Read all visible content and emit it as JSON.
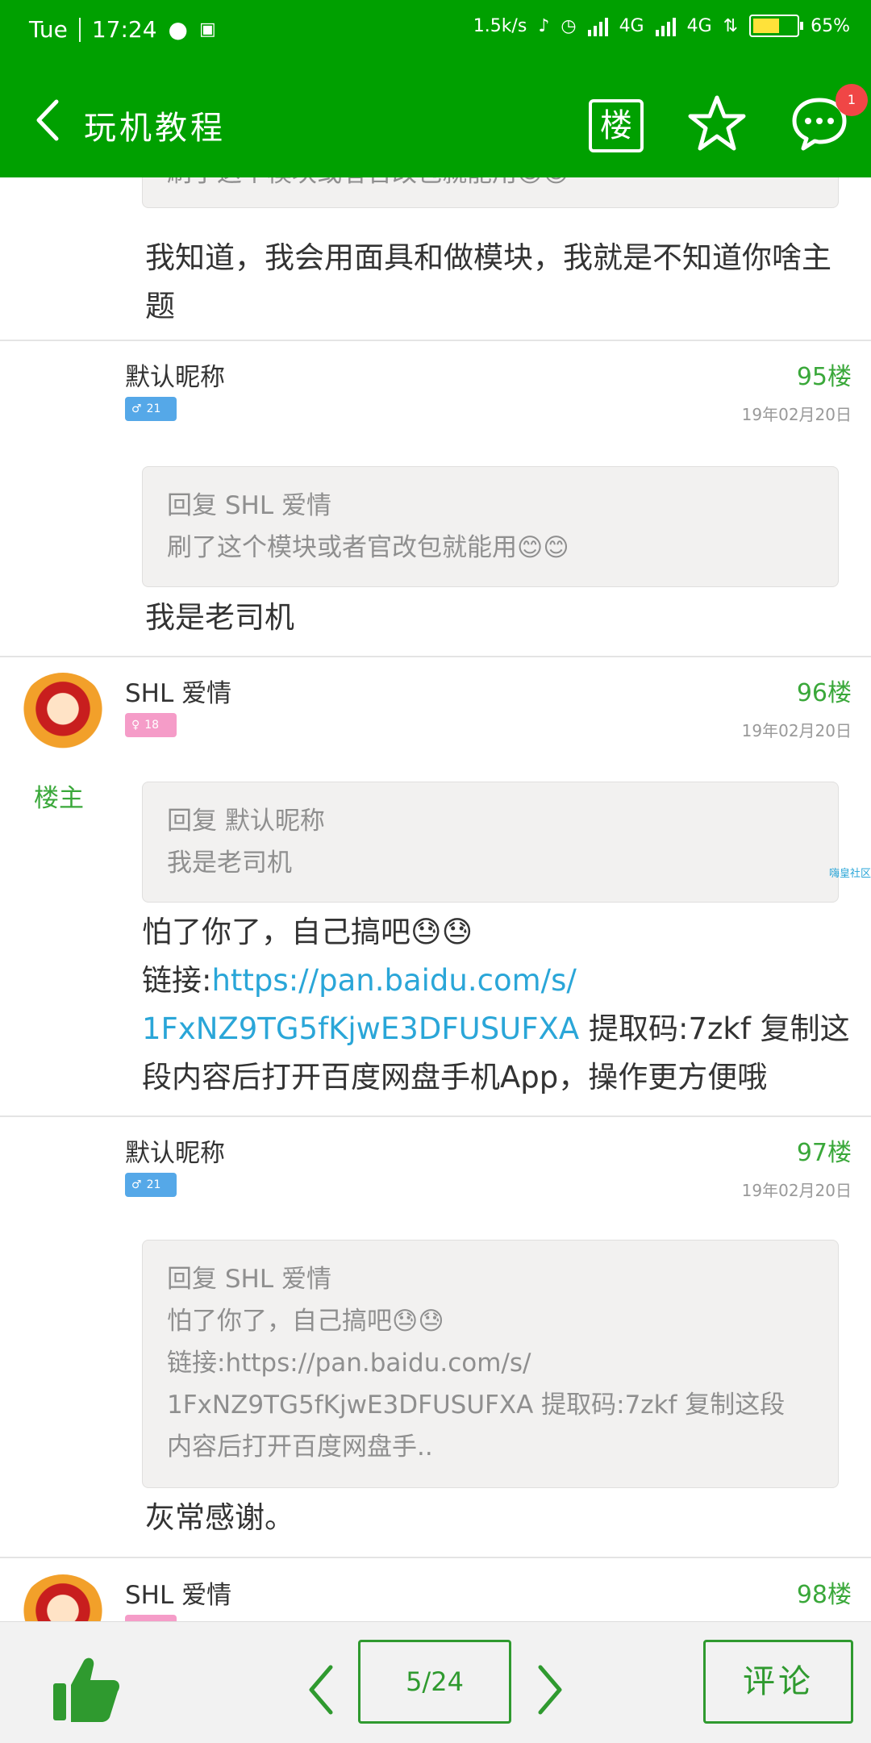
{
  "status_bar": {
    "day": "Tue",
    "time": "17:24",
    "net_speed": "1.5k/s",
    "sim1": "4G",
    "sim2": "4G",
    "battery": "65%",
    "battery_level": 0.65
  },
  "app_bar": {
    "title": "玩机教程",
    "floor_button": "楼",
    "badge_count": "1"
  },
  "posts": [
    {
      "quote_partial": "刷了这个模块或者官改包就能用😊😊",
      "text": "我知道，我会用面具和做模块，我就是不知道你啥主题"
    },
    {
      "username": "默认昵称",
      "gender": "♂",
      "age": "21",
      "floor": "95楼",
      "date": "19年02月20日",
      "quote_line1": "回复 SHL 爱情",
      "quote_line2": "刷了这个模块或者官改包就能用😊😊",
      "text": "我是老司机"
    },
    {
      "username": "SHL 爱情",
      "gender": "♀",
      "age": "18",
      "floor": "96楼",
      "date": "19年02月20日",
      "host_label": "楼主",
      "quote_line1": "回复 默认昵称",
      "quote_line2": "我是老司机",
      "text_line1": "怕了你了，自己搞吧😓😓",
      "link_prefix": "链接:",
      "link_part1": "https://pan.baidu.com/s/",
      "link_part2": "1FxNZ9TG5fKjwE3DFUSUFXA",
      "text_rest": " 提取码:7zkf 复制这段内容后打开百度网盘手机App，操作更方便哦",
      "side_tag": "嗨皇社区"
    },
    {
      "username": "默认昵称",
      "gender": "♂",
      "age": "21",
      "floor": "97楼",
      "date": "19年02月20日",
      "quote_line1": "回复 SHL 爱情",
      "quote_line2": "怕了你了，自己搞吧😓😓",
      "quote_line3": "链接:https://pan.baidu.com/s/",
      "quote_line4": "1FxNZ9TG5fKjwE3DFUSUFXA 提取码:7zkf 复制这段",
      "quote_line5": "内容后打开百度网盘手..",
      "text": "灰常感谢。"
    },
    {
      "username": "SHL 爱情",
      "floor": "98楼"
    }
  ],
  "bottom_bar": {
    "page_indicator": "5/24",
    "comment_label": "评论"
  },
  "colors": {
    "header_green": "#00a000",
    "accent_green": "#2f9a2f",
    "floor_green": "#3aa83a",
    "link_blue": "#2aa6d8",
    "badge_red": "#f04646"
  }
}
